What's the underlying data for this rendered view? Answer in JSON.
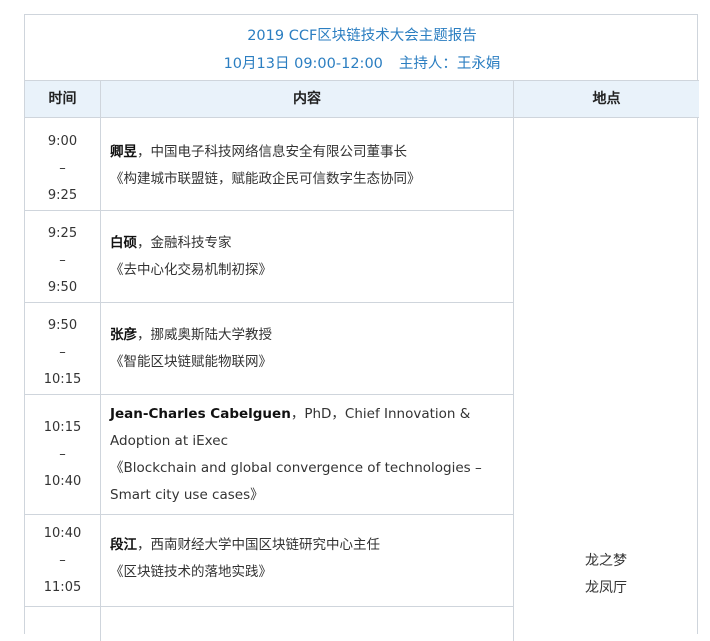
{
  "title": "2019 CCF区块链技术大会主题报告",
  "subtitle": {
    "date_time": "10月13日 09:00-12:00",
    "host": "主持人：王永娟"
  },
  "headers": {
    "time": "时间",
    "content": "内容",
    "venue": "地点"
  },
  "rows": [
    {
      "start": "9:00",
      "sep": "–",
      "end": "9:25",
      "speaker": "卿昱",
      "role": "，中国电子科技网络信息安全有限公司董事长",
      "talk": "《构建城市联盟链，赋能政企民可信数字生态协同》"
    },
    {
      "start": "9:25",
      "sep": "–",
      "end": "9:50",
      "speaker": "白硕",
      "role": "，金融科技专家",
      "talk": "《去中心化交易机制初探》"
    },
    {
      "start": "9:50",
      "sep": "–",
      "end": "10:15",
      "speaker": "张彦",
      "role": "，挪威奥斯陆大学教授",
      "talk": "《智能区块链赋能物联网》"
    },
    {
      "start": "10:15",
      "sep": "–",
      "end": "10:40",
      "speaker": "Jean-Charles Cabelguen",
      "role": "，PhD，Chief Innovation & Adoption at iExec",
      "talk": "《Blockchain and global convergence of technologies – Smart city use cases》"
    },
    {
      "start": "10:40",
      "sep": "–",
      "end": "11:05",
      "speaker": "段江",
      "role": "，西南财经大学中国区块链研究中心主任",
      "talk": "《区块链技术的落地实践》"
    }
  ],
  "venue": {
    "line1": "龙之梦",
    "line2": "龙凤厅"
  }
}
